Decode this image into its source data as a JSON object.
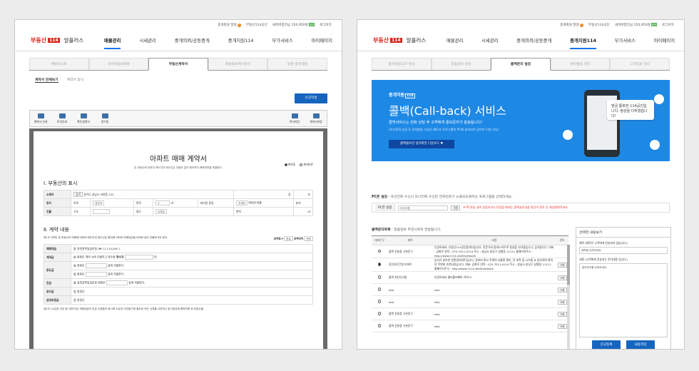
{
  "left": {
    "topbar": {
      "membership": "중개회원 말랑",
      "mileage_mark": "0",
      "point": "부동산114공인",
      "balance": "내마버충전금 150,950원",
      "balance_tag": "충전",
      "logout": "로그아웃"
    },
    "logo": {
      "brand_a": "부동산",
      "brand_b": "114",
      "product": "알플러스"
    },
    "menu": [
      "매물관리",
      "시세관리",
      "중개의뢰/공동중개",
      "중개지원114",
      "부가서비스",
      "마이페이지"
    ],
    "menu_active": 0,
    "tabs": [
      "매물리스트",
      "네이버등보매물",
      "부동산계약서",
      "매물등보매시관리",
      "방문 중개매물"
    ],
    "tab_active": 2,
    "local_nav": [
      "계약서 전체보기",
      "계약서 양식"
    ],
    "new_button": "신규작성",
    "toolbar_left": [
      "계약서 인쇄",
      "토지인쇄",
      "확인설명서",
      "영수증"
    ],
    "toolbar_right": [
      "복사저장",
      "계약서저장"
    ],
    "doc": {
      "title": "아파트 매매 계약서",
      "notice": "본 부동산에 대하여 매도인과 매수인은 다음과 같이 합의하여 매매계약을 체결한다.",
      "radio": [
        "계약중",
        "계약완료"
      ],
      "section1": "Ⅰ. 부동산의 표시",
      "rows1": [
        {
          "h": "소재지",
          "sel": "검색",
          "v": "경기도 성남시 서현동 222",
          "dong": "동",
          "ho": "호"
        },
        {
          "h": "토지",
          "k1": "지목",
          "s1": "장전지",
          "k2": "면적",
          "v2": "2",
          "u2": "㎡",
          "k3": "대지권 종류",
          "s3": "전세권",
          "k4": "대지권 비율",
          "v4": "분의"
        },
        {
          "h": "건물",
          "k1": "구조",
          "k2": "용도",
          "s2": "아파트",
          "k3": "면적",
          "u3": "㎡"
        }
      ],
      "section2": "Ⅱ. 계약 내용",
      "article1": "제1조 (목적) 위 부동산의 매매에 대하여 매도인과 매수인은 합의에 의하여 매매대금을 아래와 같이 지불하기로 한다.",
      "currency_label": "금액표시",
      "currency": "한글",
      "unit_label": "금액단위",
      "unit": "만원",
      "rows2": [
        {
          "h": "매매대금",
          "won": "金",
          "txt": "일천일백일십만원",
          "num": "(₩ 11,110,000",
          "sfx": ")"
        },
        {
          "h": "계약금",
          "won": "金",
          "txt": "원정은 계약 시에 지불하고 영수함",
          "k": "영수자",
          "v": "",
          "stamp": "印"
        },
        {
          "h": "중도금",
          "won": "金",
          "txt": "원정은",
          "tail": "일에 지불한다."
        },
        {
          "h": "",
          "won": "金",
          "txt": "원정은",
          "tail": "일에 지불한다."
        },
        {
          "h": "잔금",
          "won": "金",
          "txt": "일천일백일십만원",
          "tail2": "원정은",
          "tail": "일에 지불한다."
        },
        {
          "h": "융자금",
          "won": "金",
          "txt": "원정은"
        },
        {
          "h": "임대보증금",
          "won": "金",
          "txt": "원정은"
        }
      ],
      "article2": "제2조 (소유권 이전 등) 매도인은 매매대금의 잔금 수령함과 동시에 소유권 이전등기에 필요한 모든 서류를 교부하고 등기절차에 협력하며 위 부동산을"
    }
  },
  "right": {
    "topbar": {
      "membership": "중개회원 말랑",
      "mileage_mark": "0",
      "point": "부동산114공인",
      "balance": "내마버충전금 150,950원",
      "balance_tag": "충전",
      "logout": "로그아웃"
    },
    "logo": {
      "brand_a": "부동산",
      "brand_b": "114",
      "product": "알플러스"
    },
    "menu": [
      "매물관리",
      "시세관리",
      "중개의뢰/공동중개",
      "중개지원114",
      "부가서비스",
      "마이페이지"
    ],
    "menu_active": 3,
    "tabs": [
      "중개지원114 안내",
      "맞춤정보 설정",
      "콜백문자 설정",
      "문자발송 관리",
      "고객정보 관리"
    ],
    "tab_active": 2,
    "banner": {
      "brand": "중개지원",
      "brand_num": "114",
      "title": "콜백(Call-back) 서비스",
      "desc1": "콜백서비스는 전화 상담 후 고객에게 홍보문자가 발송됩니다!",
      "desc2": "(유선전화 상담 후 문자발송 기능은 별도의 프로그램이 PC에 설치되어 있어야 이용 가능)",
      "download": "콜백솔루션 설치파일 다운로드",
      "bubble": "방금 통화한 114공인입니다. 정성을 다하겠습니다!"
    },
    "pc": {
      "title": "PC폰 설정",
      "desc": "- 유선전화 수신시 모니터에 수신된 전화번호가 노출되도록하는 프로그램을 선택하세요.",
      "label": "PC폰 설정",
      "value": "모리스랩",
      "apply": "적용",
      "warn": "※ PC폰을 새로 설정하거나 변경할 때에는 콜백솔루션을 완전히 종료 후 재실행해주세요."
    },
    "list": {
      "title": "콜백문자목록",
      "sub": "- 맞춤정보 추천사유와 연동됩니다.",
      "headers": [
        "대표문구",
        "제목",
        "내용",
        "관리"
      ],
      "rows": [
        {
          "sel": false,
          "t": "콜백 전송용 기본문구",
          "c": "안녕하세요. 부동산114공인중개사입니다. 전문가와 중개노하우로 정성을 다하겠습니다. 감사합니다. 대표 : 김화주 연락 : 070-7011-0114 주소 : 성남시 분당구 삼평동 11111 홈페이지주소 : http://www.r114.net/S/network",
          "d": ""
        },
        {
          "sel": true,
          "t": "장안타운건영 아파트",
          "c": "농지가 분부한 친환경아파트입니다. 장마비 최고 주위의 교통편 편리, 안 초학 및 시스템 교 분부하며 최적의 주변에 추천되었습니다. 대표: 김화주 연락 : 070-7011-0114 주소 : 성남시 분당구 삼평동 11111 홈페이지주소 : http://www.r114.net/S/network",
          "d": "삭제"
        },
        {
          "sel": false,
          "t": "콜백 최신인사말",
          "c": "안녕하세요 쿨러틀러빠아 아아!!!",
          "d": "삭제"
        },
        {
          "sel": false,
          "t": "test",
          "c": "test",
          "d": "삭제"
        },
        {
          "sel": false,
          "t": "test",
          "c": "test",
          "d": "삭제"
        },
        {
          "sel": false,
          "t": "콜백 전송용 기본문구",
          "c": "test",
          "d": "삭제"
        },
        {
          "sel": false,
          "t": "콜백 전송용 기본문구",
          "c": "test",
          "d": "삭제"
        }
      ]
    },
    "detail": {
      "title": "선택한 내용보기",
      "label1": "제목 (제목은 고객에게 전송되지 않습니다.)",
      "ph1": "제목을 입력하세요.",
      "label2": "내용 (고객에게 전송되는 문자내용 입니다.)",
      "ph2": "홍보문자를 입력하세요.",
      "btn_new": "신규등록",
      "btn_save": "내용저장"
    }
  }
}
